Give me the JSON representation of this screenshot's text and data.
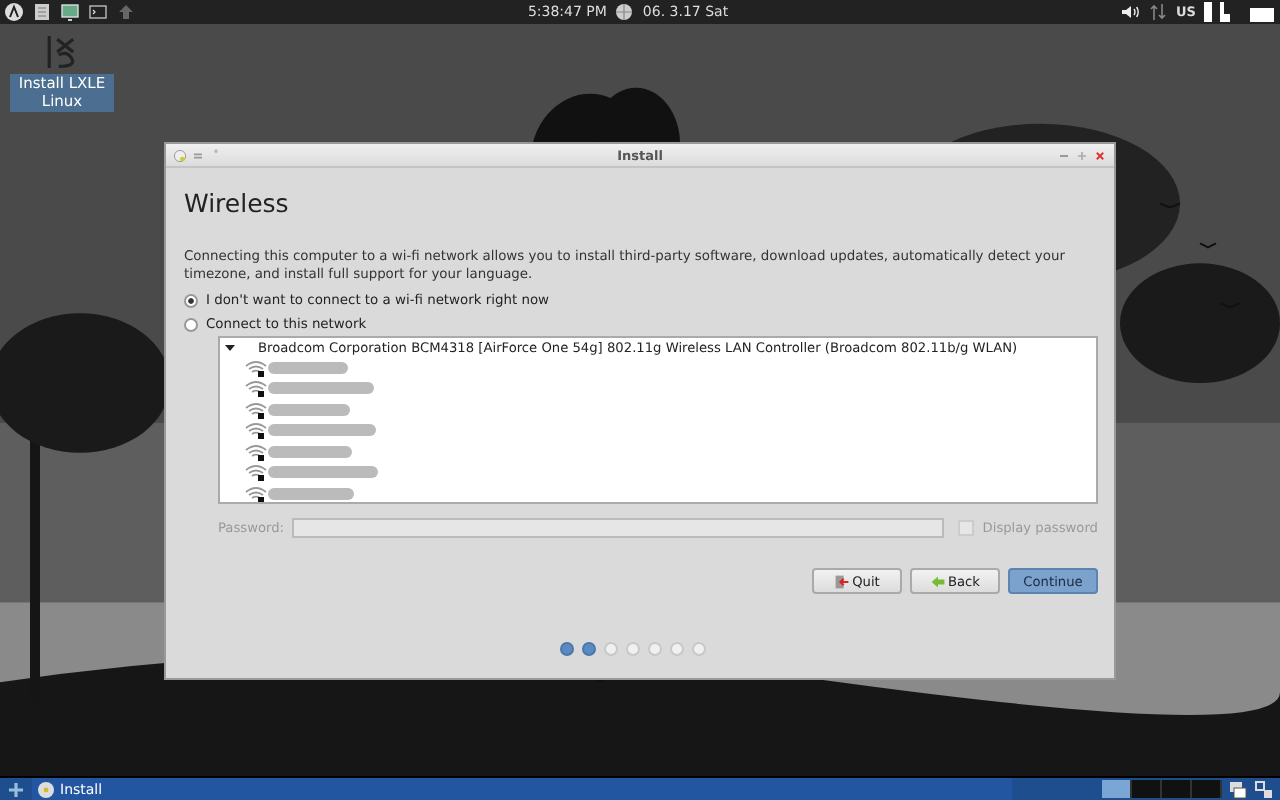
{
  "top_panel": {
    "clock": "5:38:47 PM",
    "date": "06. 3.17 Sat",
    "keyboard_layout": "US"
  },
  "desktop_icon": {
    "label": "Install LXLE Linux",
    "selected": true
  },
  "window": {
    "title": "Install",
    "heading": "Wireless",
    "description": "Connecting this computer to a wi-fi network allows you to install third-party software, download updates, automatically detect your timezone, and install full support for your language.",
    "options": [
      {
        "label": "I don't want to connect to a wi-fi network right now",
        "selected": true
      },
      {
        "label": "Connect to this network",
        "selected": false
      }
    ],
    "device": {
      "name": "Broadcom Corporation BCM4318 [AirForce One 54g] 802.11g Wireless LAN Controller (Broadcom 802.11b/g WLAN)",
      "expanded": true
    },
    "networks": [
      {
        "secured": true
      },
      {
        "secured": true
      },
      {
        "secured": true
      },
      {
        "secured": true
      },
      {
        "secured": true
      },
      {
        "secured": true
      },
      {
        "secured": true
      }
    ],
    "password": {
      "label": "Password:",
      "disabled": true
    },
    "display_password": {
      "label": "Display password",
      "checked": false,
      "disabled": true
    },
    "buttons": [
      {
        "label": "Quit",
        "kind": "quit"
      },
      {
        "label": "Back",
        "kind": "back"
      },
      {
        "label": "Continue",
        "kind": "primary"
      }
    ],
    "steps": [
      {
        "done": true
      },
      {
        "done": true
      },
      {
        "done": false
      },
      {
        "done": false
      },
      {
        "done": false
      },
      {
        "done": false
      },
      {
        "done": false
      }
    ]
  },
  "taskbar": {
    "tasks": [
      {
        "label": "Install",
        "selected": true
      }
    ]
  }
}
